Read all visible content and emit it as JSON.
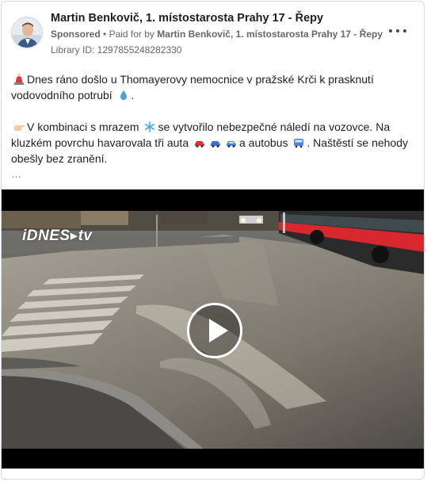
{
  "post": {
    "author": "Martin Benkovič, 1. místostarosta Prahy 17 - Řepy",
    "sponsored": "Sponsored",
    "paid_for_prefix": "Paid for by",
    "paid_for_name": "Martin Benkovič, 1. místostarosta Prahy 17 - Řepy",
    "separator": "•",
    "library_id": "Library ID: 1297855248282330",
    "paragraph1": "Dnes ráno došlo u Thomayerovy nemocnice v pražské Krči k prasknutí vodovodního potrubí",
    "paragraph2a": "V kombinaci s mrazem",
    "paragraph2b": "se vytvořilo nebezpečné náledí na vozovce. Na kluzkém povrchu havarovala tři auta",
    "paragraph2c": "a autobus",
    "paragraph2d": ". Naštěstí se nehody obešly bez zranění.",
    "see_more": "…",
    "period": "."
  },
  "video": {
    "watermark": "iDNES▸tv"
  },
  "icons": {
    "more": "more-options-icon",
    "play": "play-icon",
    "siren": "siren-emoji-icon",
    "droplet": "droplet-emoji-icon",
    "pointing_hand": "pointing-hand-emoji-icon",
    "snowflake": "snowflake-emoji-icon",
    "car": "car-emoji-icon",
    "bus": "bus-emoji-icon"
  },
  "colors": {
    "text": "#1c1e21",
    "secondary": "#65676b",
    "bus_red": "#d7282f"
  }
}
